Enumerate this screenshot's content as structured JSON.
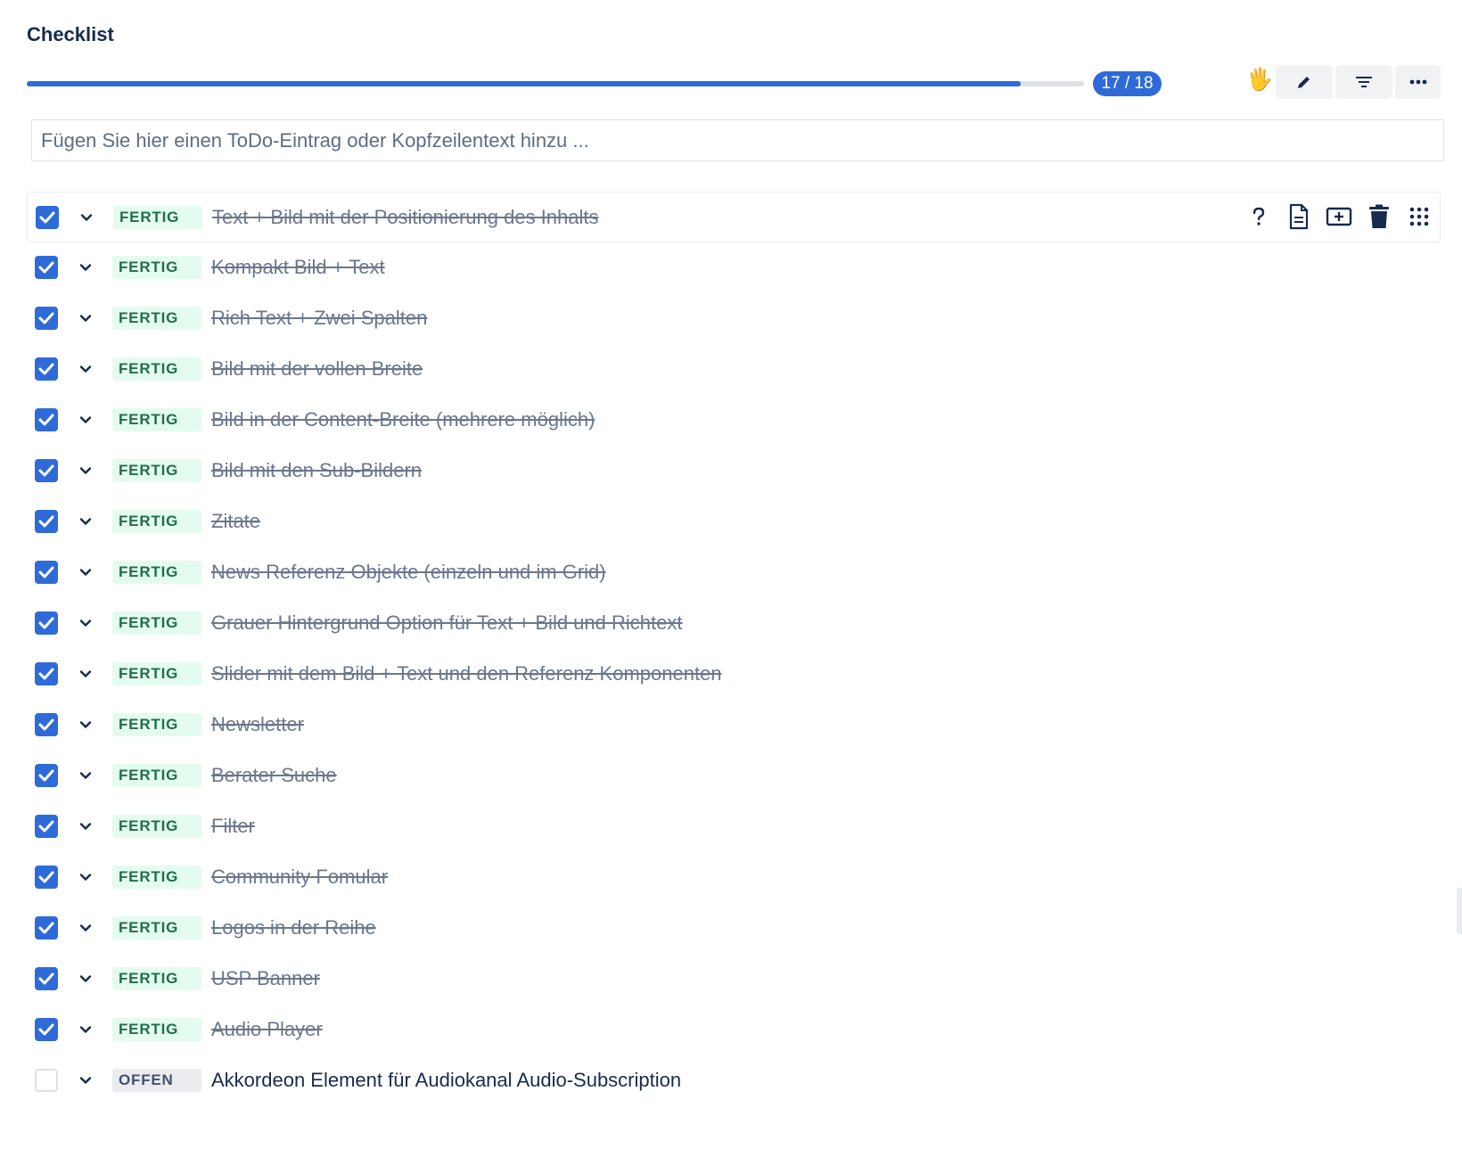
{
  "header": {
    "title": "Checklist"
  },
  "progress": {
    "done": 17,
    "total": 18,
    "label": "17 / 18",
    "fraction": 0.94
  },
  "toolbar": {
    "hand_icon": "raised-hand",
    "buttons": [
      "pencil-icon",
      "filter-icon",
      "more-icon"
    ]
  },
  "add_item": {
    "placeholder": "Fügen Sie hier einen ToDo-Eintrag oder Kopfzeilentext hinzu ..."
  },
  "row_actions": [
    "help-icon",
    "document-icon",
    "add-section-icon",
    "trash-icon",
    "drag-grid-icon"
  ],
  "items": [
    {
      "checked": true,
      "status": "FERTIG",
      "text": "Text + Bild mit der Positionierung des Inhalts"
    },
    {
      "checked": true,
      "status": "FERTIG",
      "text": "Kompakt Bild + Text"
    },
    {
      "checked": true,
      "status": "FERTIG",
      "text": "Rich Text + Zwei Spalten"
    },
    {
      "checked": true,
      "status": "FERTIG",
      "text": "Bild mit der vollen Breite"
    },
    {
      "checked": true,
      "status": "FERTIG",
      "text": "Bild in der Content-Breite (mehrere möglich)"
    },
    {
      "checked": true,
      "status": "FERTIG",
      "text": "Bild mit den Sub-Bildern"
    },
    {
      "checked": true,
      "status": "FERTIG",
      "text": "Zitate"
    },
    {
      "checked": true,
      "status": "FERTIG",
      "text": "News Referenz Objekte (einzeln und im Grid)"
    },
    {
      "checked": true,
      "status": "FERTIG",
      "text": "Grauer Hintergrund Option für Text + Bild und Richtext"
    },
    {
      "checked": true,
      "status": "FERTIG",
      "text": "Slider mit dem Bild + Text und den Referenz Komponenten"
    },
    {
      "checked": true,
      "status": "FERTIG",
      "text": "Newsletter"
    },
    {
      "checked": true,
      "status": "FERTIG",
      "text": "Berater Suche"
    },
    {
      "checked": true,
      "status": "FERTIG",
      "text": "Filter"
    },
    {
      "checked": true,
      "status": "FERTIG",
      "text": "Community Fomular"
    },
    {
      "checked": true,
      "status": "FERTIG",
      "text": "Logos in der Reihe"
    },
    {
      "checked": true,
      "status": "FERTIG",
      "text": "USP Banner"
    },
    {
      "checked": true,
      "status": "FERTIG",
      "text": "Audio Player"
    },
    {
      "checked": false,
      "status": "OFFEN",
      "text": "Akkordeon Element für Audiokanal Audio-Subscription"
    }
  ],
  "colors": {
    "accent": "#2f6bd8",
    "done_badge_bg": "#e3fcef",
    "done_badge_text": "#216e4e",
    "open_badge_bg": "#ebecf0"
  }
}
